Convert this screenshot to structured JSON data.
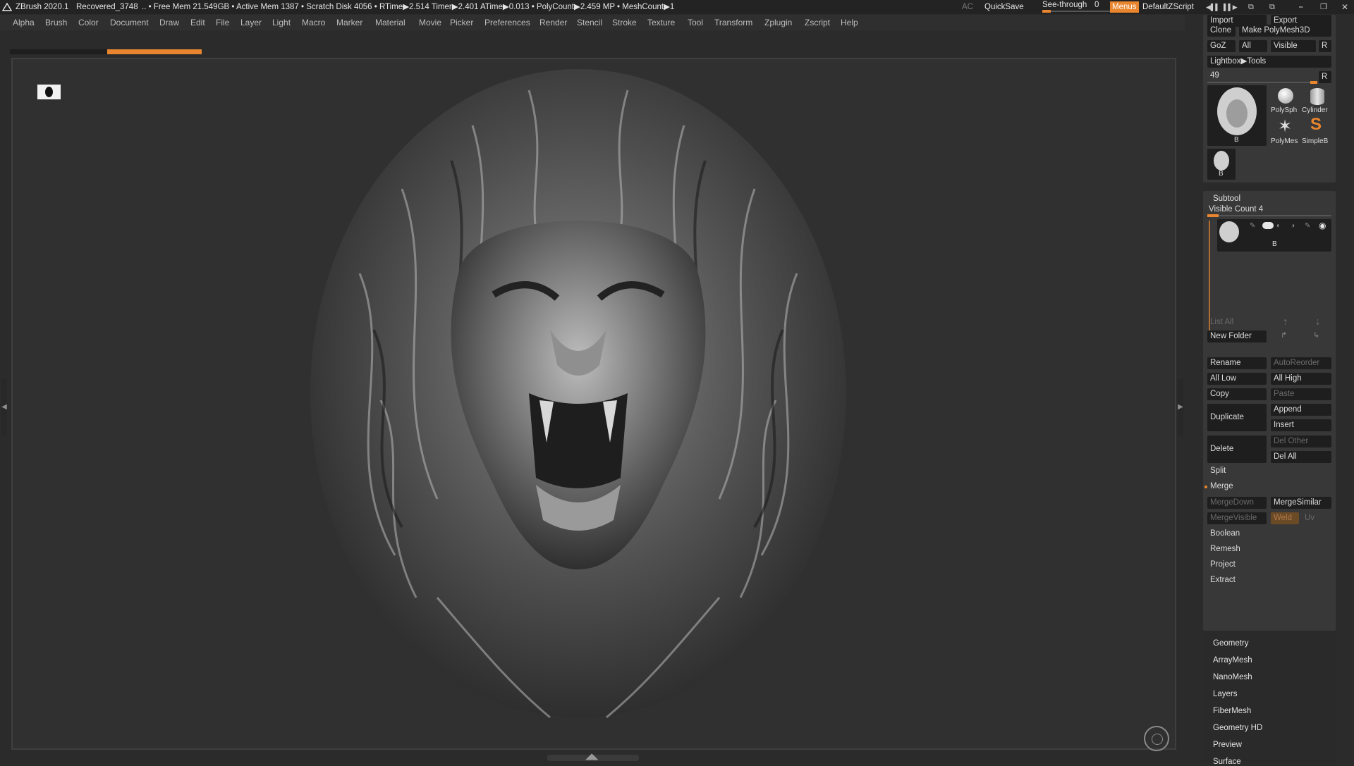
{
  "titlebar": {
    "app": "ZBrush 2020.1",
    "file": "Recovered_3748",
    "stats": ".. • Free Mem 21.549GB • Active Mem 1387 • Scratch Disk 4056 •  RTime▶2.514 Timer▶2.401 ATime▶0.013 • PolyCount▶2.459 MP  • MeshCount▶1",
    "ac": "AC",
    "quicksave": "QuickSave",
    "seethrough": "See-through",
    "seethrough_value": "0",
    "menus": "Menus",
    "script": "DefaultZScript",
    "accent": "#e9852e"
  },
  "menu": [
    "Alpha",
    "Brush",
    "Color",
    "Document",
    "Draw",
    "Edit",
    "File",
    "Layer",
    "Light",
    "Macro",
    "Marker",
    "Material",
    "Movie",
    "Picker",
    "Preferences",
    "Render",
    "Stencil",
    "Stroke",
    "Texture",
    "Tool",
    "Transform",
    "Zplugin",
    "Zscript",
    "Help"
  ],
  "panel": {
    "import": "Import",
    "export": "Export",
    "clone": "Clone",
    "make_polymesh": "Make PolyMesh3D",
    "goz": "GoZ",
    "all": "All",
    "visible": "Visible",
    "r": "R",
    "lightbox_tools": "Lightbox▶Tools",
    "slider_value": "49",
    "tool_main_label": "B",
    "polysphere": "PolySph",
    "cylinder": "Cylinder",
    "polymesh": "PolyMes",
    "simpleb": "SimpleB",
    "tool_small_label": "B"
  },
  "subtool": {
    "title": "Subtool",
    "visible_count": "Visible Count 4",
    "item_label": "B",
    "list_all": "List All",
    "new_folder": "New Folder",
    "rename": "Rename",
    "autoreorder": "AutoReorder",
    "all_low": "All Low",
    "all_high": "All High",
    "copy": "Copy",
    "paste": "Paste",
    "duplicate": "Duplicate",
    "append": "Append",
    "insert": "Insert",
    "delete": "Delete",
    "del_other": "Del Other",
    "del_all": "Del All",
    "split": "Split",
    "merge": "Merge",
    "mergedown": "MergeDown",
    "mergesimilar": "MergeSimilar",
    "mergevisible": "MergeVisible",
    "weld": "Weld",
    "uv": "Uv",
    "boolean": "Boolean",
    "remesh": "Remesh",
    "project": "Project",
    "extract": "Extract"
  },
  "tool_sections": [
    "Geometry",
    "ArrayMesh",
    "NanoMesh",
    "Layers",
    "FiberMesh",
    "Geometry HD",
    "Preview",
    "Surface"
  ]
}
